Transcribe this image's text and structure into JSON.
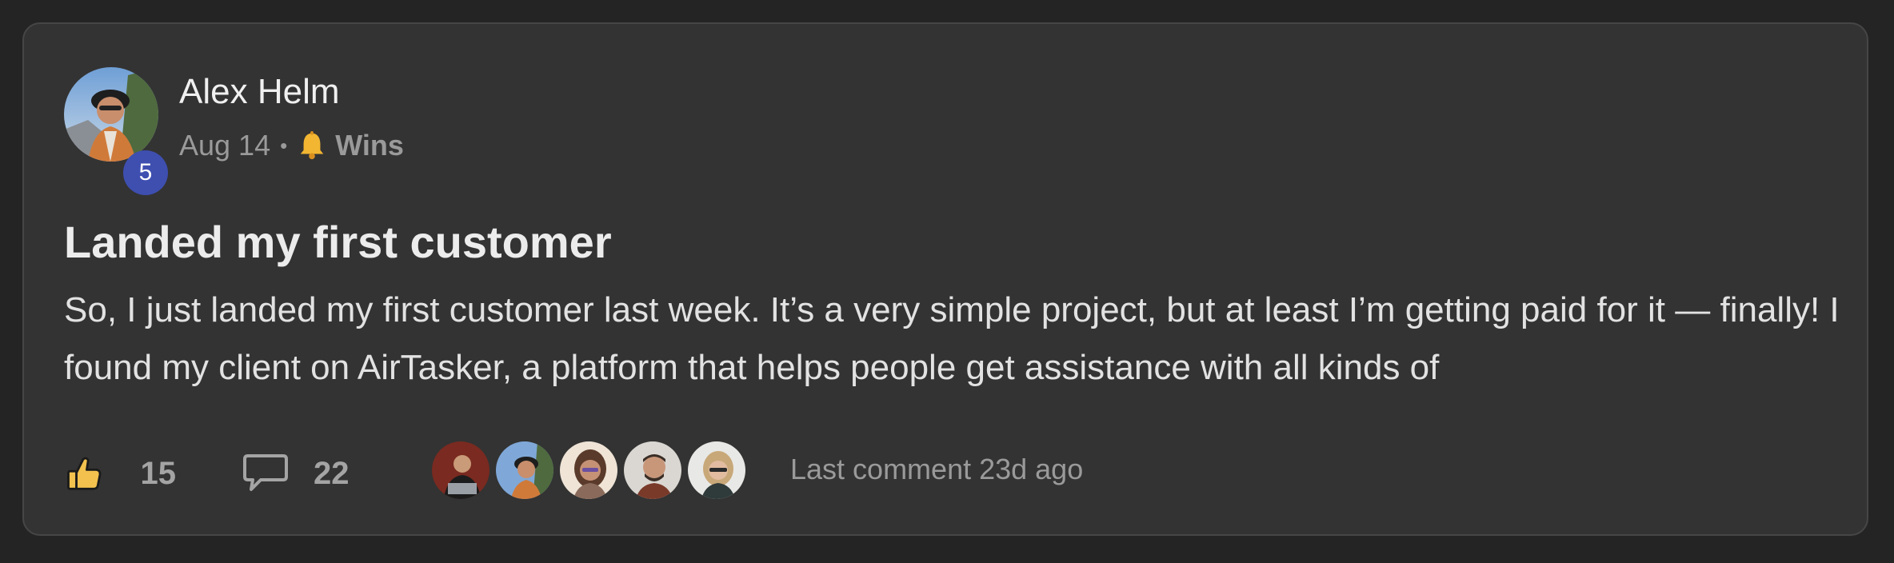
{
  "post": {
    "author": {
      "name": "Alex Helm",
      "level": "5",
      "avatar_icon": "user-avatar-photo"
    },
    "date": "Aug 14",
    "separator": "•",
    "category": {
      "icon": "bell-icon",
      "label": "Wins"
    },
    "title": "Landed my first customer",
    "body": "So, I just landed my first customer last week. It’s a very simple project, but at least I’m getting paid for it — finally! I found my client on AirTasker, a platform that helps people get assistance with all kinds of",
    "likes": {
      "icon": "thumbs-up-icon",
      "count": "15"
    },
    "comments": {
      "icon": "comment-bubble-icon",
      "count": "22"
    },
    "commenters": [
      {
        "name": "commenter-avatar-1"
      },
      {
        "name": "commenter-avatar-2"
      },
      {
        "name": "commenter-avatar-3"
      },
      {
        "name": "commenter-avatar-4"
      },
      {
        "name": "commenter-avatar-5"
      }
    ],
    "last_comment": "Last comment 23d ago"
  },
  "colors": {
    "page_bg": "#242424",
    "card_bg": "#333333",
    "card_border": "#464646",
    "level_badge": "#3e4fb0",
    "muted_text": "#9a9a9a",
    "like_accent": "#f2c14e"
  }
}
